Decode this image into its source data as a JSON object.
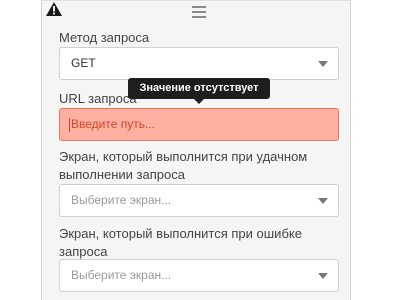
{
  "form": {
    "method_label": "Метод запроса",
    "method_value": "GET",
    "url_label": "URL запроса",
    "url_placeholder": "Введите путь...",
    "url_error_tooltip": "Значение отсутствует",
    "success_screen_label": "Экран, который выполнится при удачном выполнении запроса",
    "success_screen_placeholder": "Выберите экран...",
    "error_screen_label": "Экран, который выполнится при ошибке запроса",
    "error_screen_placeholder": "Выберите экран..."
  },
  "icons": {
    "warning": "warning-icon",
    "drag": "drag-handle-icon",
    "dropdown": "chevron-down-icon"
  },
  "colors": {
    "panel_bg": "#f5f5f5",
    "error_bg": "#ffb0a0",
    "error_border": "#e07b63",
    "error_text": "#d0462b",
    "tooltip_bg": "#1e1e1e"
  }
}
